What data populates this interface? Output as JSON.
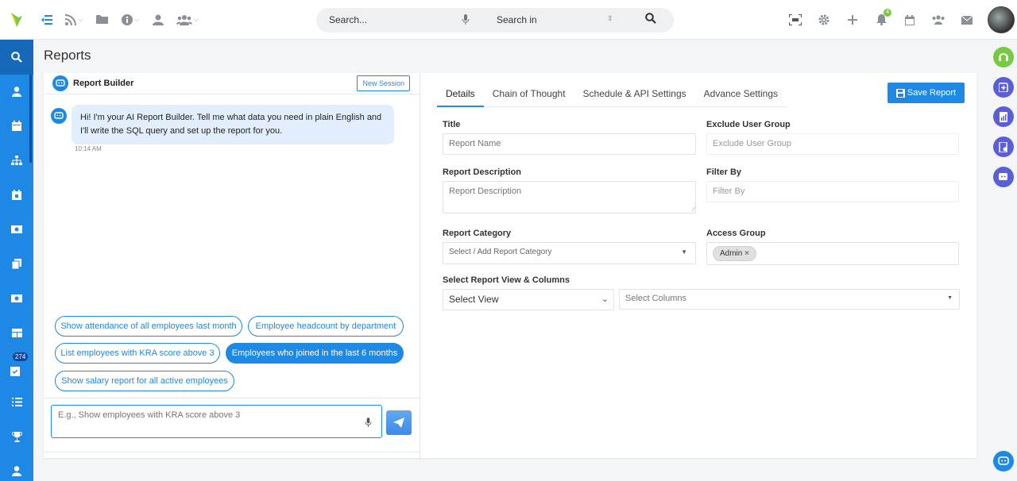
{
  "page": {
    "title": "Reports"
  },
  "search": {
    "placeholder": "Search...",
    "search_in": "Search in"
  },
  "notifications": {
    "count": "4"
  },
  "sidebar": {
    "badge": "274"
  },
  "chat": {
    "title": "Report Builder",
    "new_session": "New Session",
    "message": "Hi! I'm your AI Report Builder. Tell me what data you need in plain English and I'll write the SQL query and set up the report for you.",
    "time": "10:14 AM",
    "suggestions": [
      "Show attendance of all employees last month",
      "Employee headcount by department",
      "List employees with KRA score above 3",
      "Employees who joined in the last 6 months",
      "Show salary report for all active employees"
    ],
    "input_placeholder": "E.g., Show employees with KRA score above 3"
  },
  "tabs": [
    "Details",
    "Chain of Thought",
    "Schedule & API Settings",
    "Advance Settings"
  ],
  "save_label": "Save Report",
  "form": {
    "title_label": "Title",
    "title_placeholder": "Report Name",
    "exclude_label": "Exclude User Group",
    "exclude_placeholder": "Exclude User Group",
    "desc_label": "Report Description",
    "desc_placeholder": "Report Description",
    "filter_label": "Filter By",
    "filter_placeholder": "Filter By",
    "category_label": "Report Category",
    "category_placeholder": "Select / Add Report Category",
    "access_label": "Access Group",
    "access_tag": "Admin",
    "view_label": "Select Report View & Columns",
    "view_value": "Select View",
    "columns_placeholder": "Select Columns"
  },
  "colors": {
    "primary": "#1e88e5",
    "sidebar": "#1e88e5",
    "bubble": "#e3eefc",
    "badge": "#7ac943"
  }
}
